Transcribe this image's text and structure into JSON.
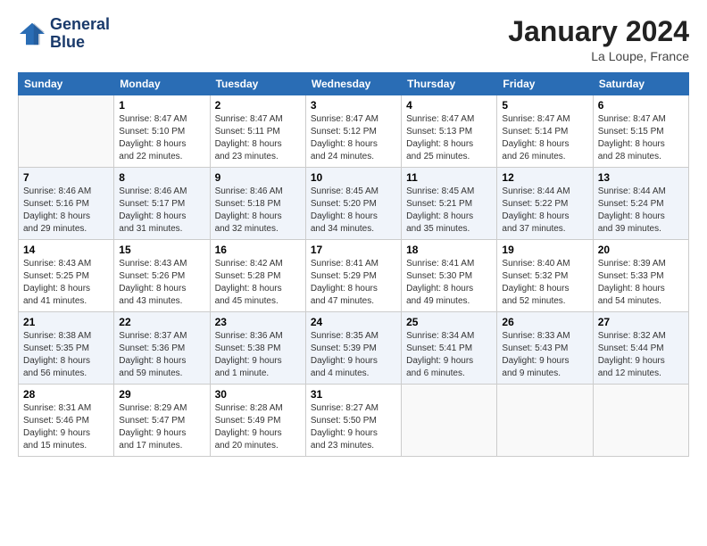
{
  "header": {
    "logo_line1": "General",
    "logo_line2": "Blue",
    "month_title": "January 2024",
    "location": "La Loupe, France"
  },
  "weekdays": [
    "Sunday",
    "Monday",
    "Tuesday",
    "Wednesday",
    "Thursday",
    "Friday",
    "Saturday"
  ],
  "weeks": [
    [
      {
        "day": "",
        "info": ""
      },
      {
        "day": "1",
        "info": "Sunrise: 8:47 AM\nSunset: 5:10 PM\nDaylight: 8 hours\nand 22 minutes."
      },
      {
        "day": "2",
        "info": "Sunrise: 8:47 AM\nSunset: 5:11 PM\nDaylight: 8 hours\nand 23 minutes."
      },
      {
        "day": "3",
        "info": "Sunrise: 8:47 AM\nSunset: 5:12 PM\nDaylight: 8 hours\nand 24 minutes."
      },
      {
        "day": "4",
        "info": "Sunrise: 8:47 AM\nSunset: 5:13 PM\nDaylight: 8 hours\nand 25 minutes."
      },
      {
        "day": "5",
        "info": "Sunrise: 8:47 AM\nSunset: 5:14 PM\nDaylight: 8 hours\nand 26 minutes."
      },
      {
        "day": "6",
        "info": "Sunrise: 8:47 AM\nSunset: 5:15 PM\nDaylight: 8 hours\nand 28 minutes."
      }
    ],
    [
      {
        "day": "7",
        "info": "Sunrise: 8:46 AM\nSunset: 5:16 PM\nDaylight: 8 hours\nand 29 minutes."
      },
      {
        "day": "8",
        "info": "Sunrise: 8:46 AM\nSunset: 5:17 PM\nDaylight: 8 hours\nand 31 minutes."
      },
      {
        "day": "9",
        "info": "Sunrise: 8:46 AM\nSunset: 5:18 PM\nDaylight: 8 hours\nand 32 minutes."
      },
      {
        "day": "10",
        "info": "Sunrise: 8:45 AM\nSunset: 5:20 PM\nDaylight: 8 hours\nand 34 minutes."
      },
      {
        "day": "11",
        "info": "Sunrise: 8:45 AM\nSunset: 5:21 PM\nDaylight: 8 hours\nand 35 minutes."
      },
      {
        "day": "12",
        "info": "Sunrise: 8:44 AM\nSunset: 5:22 PM\nDaylight: 8 hours\nand 37 minutes."
      },
      {
        "day": "13",
        "info": "Sunrise: 8:44 AM\nSunset: 5:24 PM\nDaylight: 8 hours\nand 39 minutes."
      }
    ],
    [
      {
        "day": "14",
        "info": "Sunrise: 8:43 AM\nSunset: 5:25 PM\nDaylight: 8 hours\nand 41 minutes."
      },
      {
        "day": "15",
        "info": "Sunrise: 8:43 AM\nSunset: 5:26 PM\nDaylight: 8 hours\nand 43 minutes."
      },
      {
        "day": "16",
        "info": "Sunrise: 8:42 AM\nSunset: 5:28 PM\nDaylight: 8 hours\nand 45 minutes."
      },
      {
        "day": "17",
        "info": "Sunrise: 8:41 AM\nSunset: 5:29 PM\nDaylight: 8 hours\nand 47 minutes."
      },
      {
        "day": "18",
        "info": "Sunrise: 8:41 AM\nSunset: 5:30 PM\nDaylight: 8 hours\nand 49 minutes."
      },
      {
        "day": "19",
        "info": "Sunrise: 8:40 AM\nSunset: 5:32 PM\nDaylight: 8 hours\nand 52 minutes."
      },
      {
        "day": "20",
        "info": "Sunrise: 8:39 AM\nSunset: 5:33 PM\nDaylight: 8 hours\nand 54 minutes."
      }
    ],
    [
      {
        "day": "21",
        "info": "Sunrise: 8:38 AM\nSunset: 5:35 PM\nDaylight: 8 hours\nand 56 minutes."
      },
      {
        "day": "22",
        "info": "Sunrise: 8:37 AM\nSunset: 5:36 PM\nDaylight: 8 hours\nand 59 minutes."
      },
      {
        "day": "23",
        "info": "Sunrise: 8:36 AM\nSunset: 5:38 PM\nDaylight: 9 hours\nand 1 minute."
      },
      {
        "day": "24",
        "info": "Sunrise: 8:35 AM\nSunset: 5:39 PM\nDaylight: 9 hours\nand 4 minutes."
      },
      {
        "day": "25",
        "info": "Sunrise: 8:34 AM\nSunset: 5:41 PM\nDaylight: 9 hours\nand 6 minutes."
      },
      {
        "day": "26",
        "info": "Sunrise: 8:33 AM\nSunset: 5:43 PM\nDaylight: 9 hours\nand 9 minutes."
      },
      {
        "day": "27",
        "info": "Sunrise: 8:32 AM\nSunset: 5:44 PM\nDaylight: 9 hours\nand 12 minutes."
      }
    ],
    [
      {
        "day": "28",
        "info": "Sunrise: 8:31 AM\nSunset: 5:46 PM\nDaylight: 9 hours\nand 15 minutes."
      },
      {
        "day": "29",
        "info": "Sunrise: 8:29 AM\nSunset: 5:47 PM\nDaylight: 9 hours\nand 17 minutes."
      },
      {
        "day": "30",
        "info": "Sunrise: 8:28 AM\nSunset: 5:49 PM\nDaylight: 9 hours\nand 20 minutes."
      },
      {
        "day": "31",
        "info": "Sunrise: 8:27 AM\nSunset: 5:50 PM\nDaylight: 9 hours\nand 23 minutes."
      },
      {
        "day": "",
        "info": ""
      },
      {
        "day": "",
        "info": ""
      },
      {
        "day": "",
        "info": ""
      }
    ]
  ]
}
